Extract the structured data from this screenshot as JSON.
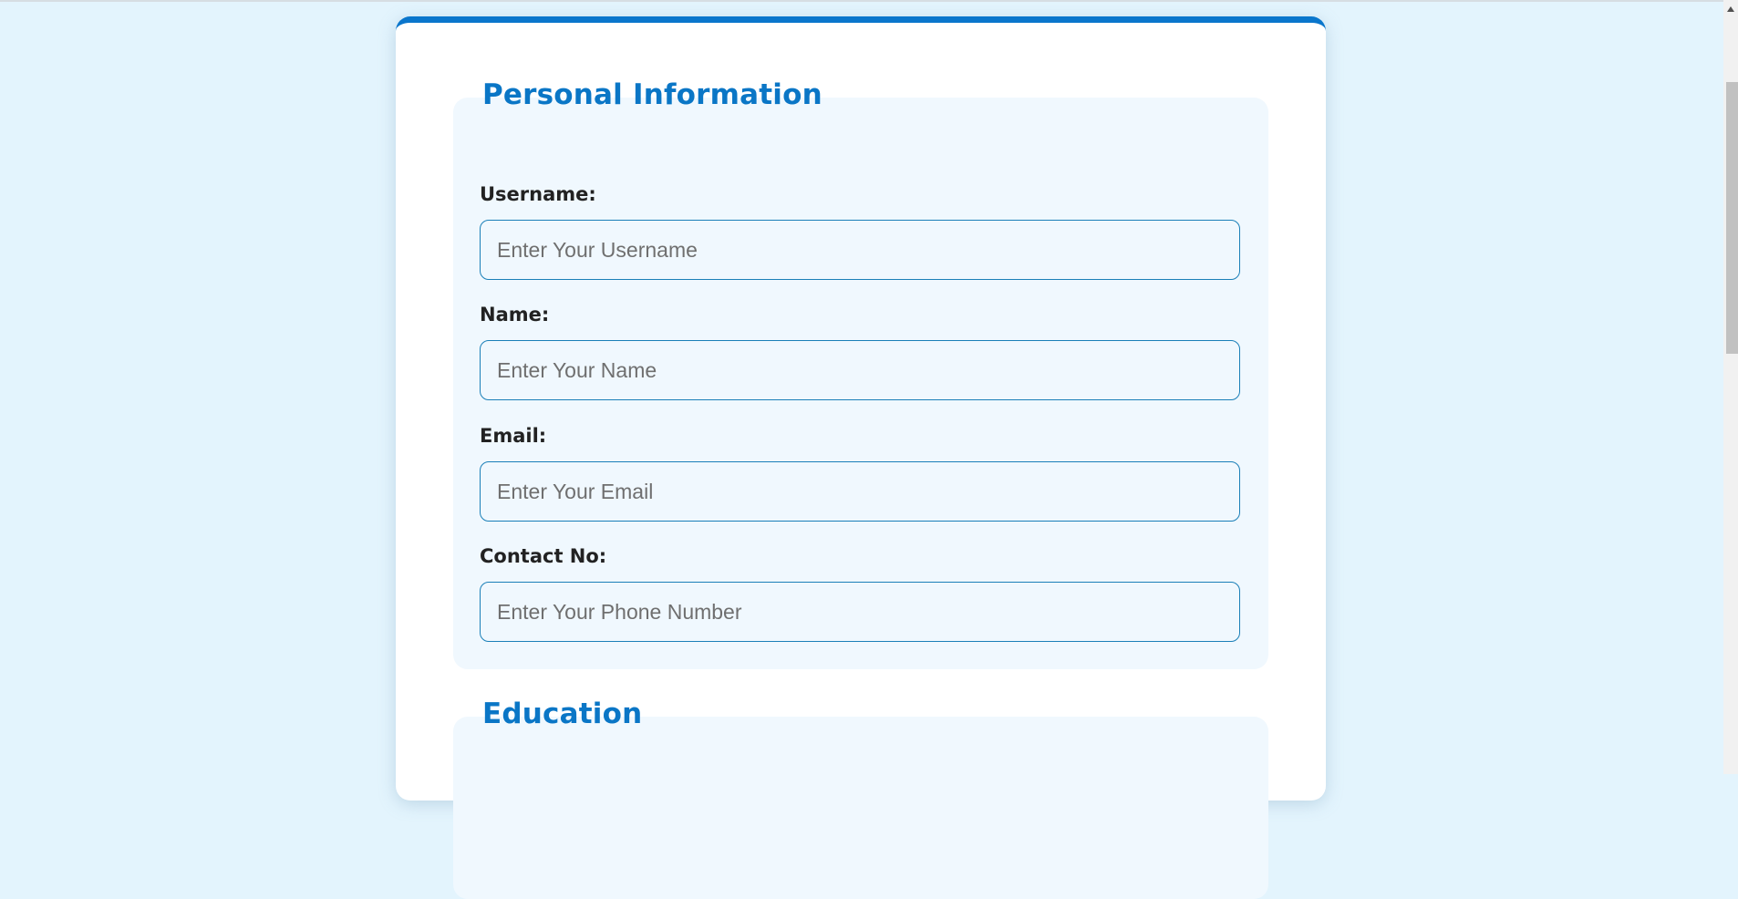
{
  "form": {
    "personal": {
      "title": "Personal Information",
      "fields": [
        {
          "label": "Username:",
          "placeholder": "Enter Your Username",
          "value": ""
        },
        {
          "label": "Name:",
          "placeholder": "Enter Your Name",
          "value": ""
        },
        {
          "label": "Email:",
          "placeholder": "Enter Your Email",
          "value": ""
        },
        {
          "label": "Contact No:",
          "placeholder": "Enter Your Phone Number",
          "value": ""
        }
      ]
    },
    "education": {
      "title": "Education"
    }
  },
  "colors": {
    "page_background": "#e3f4fd",
    "accent": "#0a76cc",
    "section_background": "#f0f8fe",
    "input_border": "#1a7fb8"
  }
}
